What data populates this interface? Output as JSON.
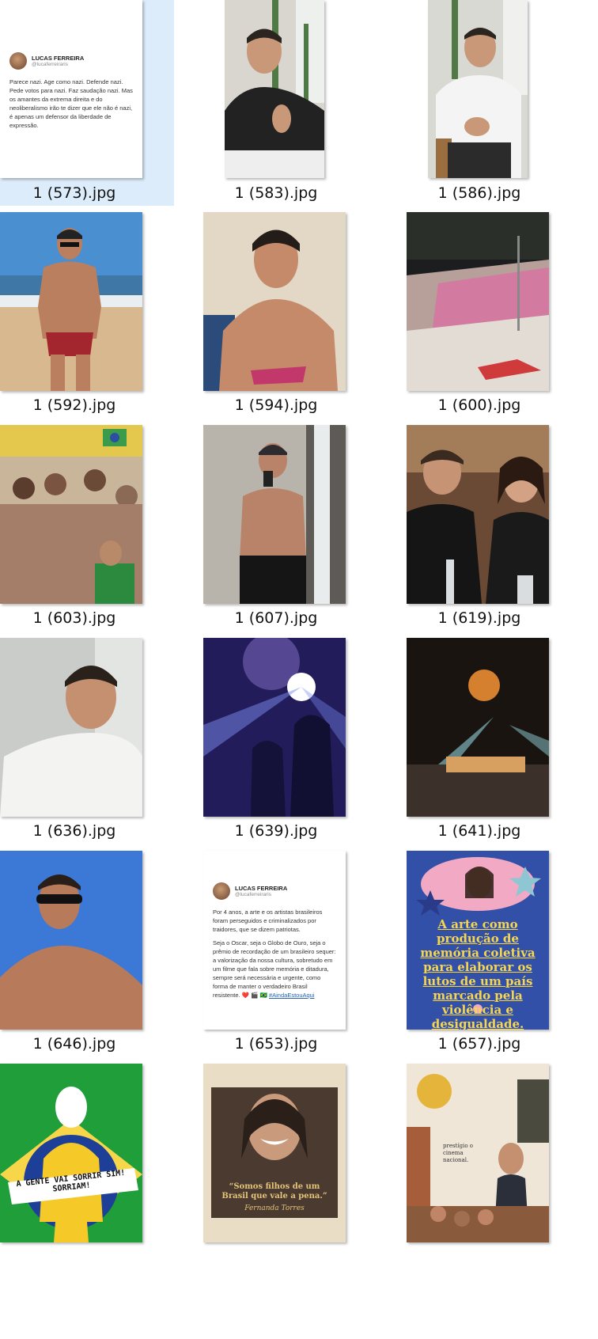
{
  "files": [
    {
      "name": "1 (573).jpg",
      "kind": "tweet-screenshot",
      "selected": true
    },
    {
      "name": "1 (583).jpg",
      "kind": "man-black-tshirt-selfie"
    },
    {
      "name": "1 (586).jpg",
      "kind": "man-white-tshirt-seated"
    },
    {
      "name": "1 (592).jpg",
      "kind": "man-beach-red-trunks"
    },
    {
      "name": "1 (594).jpg",
      "kind": "man-sand-selfie"
    },
    {
      "name": "1 (600).jpg",
      "kind": "crowd-street-night"
    },
    {
      "name": "1 (603).jpg",
      "kind": "samba-party-crowd"
    },
    {
      "name": "1 (607).jpg",
      "kind": "mirror-selfie-shirtless"
    },
    {
      "name": "1 (619).jpg",
      "kind": "dinner-couple"
    },
    {
      "name": "1 (636).jpg",
      "kind": "man-white-shirt-selfie"
    },
    {
      "name": "1 (639).jpg",
      "kind": "concert-blue-lights"
    },
    {
      "name": "1 (641).jpg",
      "kind": "concert-stage-orchestra"
    },
    {
      "name": "1 (646).jpg",
      "kind": "man-sunglasses-sky"
    },
    {
      "name": "1 (653).jpg",
      "kind": "tweet-screenshot-2"
    },
    {
      "name": "1 (657).jpg",
      "kind": "poster-arte-memoria"
    },
    {
      "name": "",
      "kind": "illustration-green"
    },
    {
      "name": "",
      "kind": "poster-fernanda-torres"
    },
    {
      "name": "",
      "kind": "collage-cinema"
    }
  ],
  "tweet1": {
    "name": "LUCAS FERREIRA",
    "handle": "@lucaferreiraris",
    "text": "Parece nazi. Age como nazi. Defende nazi. Pede votos para nazi. Faz saudação nazi. Mas os amantes da extrema direita e do neoliberalismo irão te dizer que ele não é nazi, é apenas um defensor da liberdade de expressão."
  },
  "tweet2": {
    "name": "LUCAS FERREIRA",
    "handle": "@lucaferreiraris",
    "p1": "Por 4 anos, a arte e os artistas brasileiros foram perseguidos e criminalizados por traidores, que se dizem patriotas.",
    "p2": "Seja o Oscar, seja o Globo de Ouro, seja o prêmio de recordação de um brasileiro sequer: a valorização da nossa cultura, sobretudo em um filme que fala sobre memória e ditadura, sempre será necessária e urgente, como forma de manter o verdadeiro Brasil resistente. ❤️ 🎬 🇧🇷",
    "tag": "#AindaEstouAqui"
  },
  "poster1": {
    "text": "A arte como produção de memória coletiva para elaborar os lutos de um país marcado pela violência e desigualdade."
  },
  "poster2": {
    "banner": "A GENTE VAI SORRIR SIM! SORRIAM!"
  },
  "poster3": {
    "quote": "“Somos filhos de um Brasil que vale a pena.”",
    "author": "Fernanda Torres"
  },
  "poster4": {
    "text": "prestígio o cinema nacional."
  },
  "colors": {
    "selection": "#dcecfb",
    "caption": "#111111",
    "poster_blue": "#3350a8",
    "poster_yellow": "#f7d64a",
    "green": "#1f9e3a"
  }
}
